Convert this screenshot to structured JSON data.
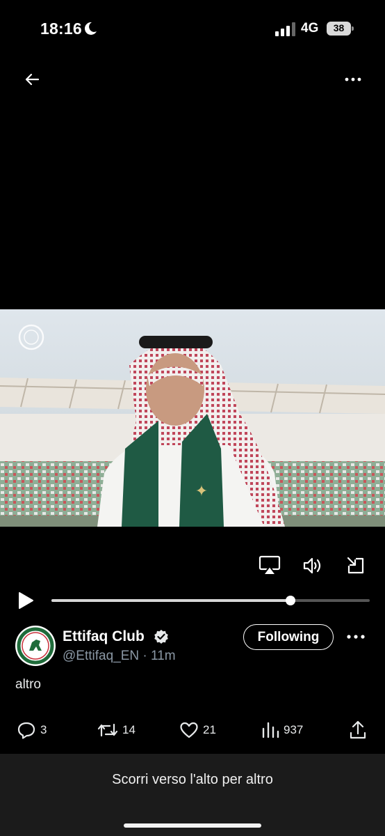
{
  "status_bar": {
    "time": "18:16",
    "network": "4G",
    "battery": "38"
  },
  "nav": {
    "back_icon": "arrow-left-icon",
    "more_icon": "more-horizontal-icon"
  },
  "video": {
    "progress": 0.75,
    "controls": [
      "airplay-icon",
      "volume-icon",
      "exit-fullscreen-icon"
    ]
  },
  "post": {
    "display_name": "Ettifaq Club",
    "handle_time": "@Ettifaq_EN · 11m",
    "follow_label": "Following",
    "text": "altro",
    "stats": {
      "replies": "3",
      "reposts": "14",
      "likes": "21",
      "views": "937"
    }
  },
  "banner": {
    "text": "Scorri verso l'alto per altro"
  },
  "colors": {
    "background": "#000000",
    "secondary_text": "#8b98a5",
    "banner_bg": "#1b1b1b"
  }
}
